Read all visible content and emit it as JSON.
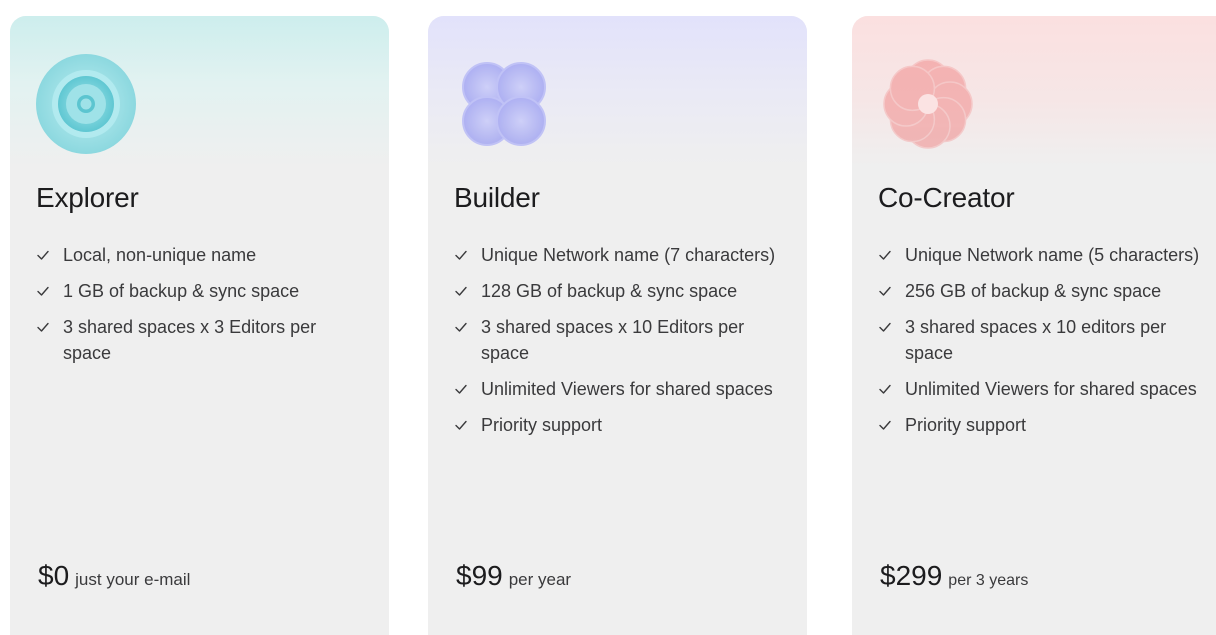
{
  "plans": [
    {
      "name": "Explorer",
      "logo_icon": "concentric-circles-icon",
      "accent": "#8fd9df",
      "features": [
        "Local, non-unique name",
        "1 GB of backup & sync space",
        "3 shared spaces x 3 Editors per space"
      ],
      "price": "$0",
      "price_note": "just your e-mail"
    },
    {
      "name": "Builder",
      "logo_icon": "four-circles-icon",
      "accent": "#a9abf3",
      "features": [
        "Unique Network name (7 characters)",
        "128 GB of backup & sync space",
        "3 shared spaces x 10 Editors per space",
        "Unlimited Viewers for shared spaces",
        "Priority support"
      ],
      "price": "$99",
      "price_note": "per year"
    },
    {
      "name": "Co-Creator",
      "logo_icon": "flower-petals-icon",
      "accent": "#f09a9a",
      "features": [
        "Unique Network name (5 characters)",
        "256 GB of backup & sync space",
        "3 shared spaces x 10 editors per space",
        "Unlimited Viewers for shared spaces",
        "Priority support"
      ],
      "price": "$299",
      "price_note": "per 3 years"
    }
  ]
}
